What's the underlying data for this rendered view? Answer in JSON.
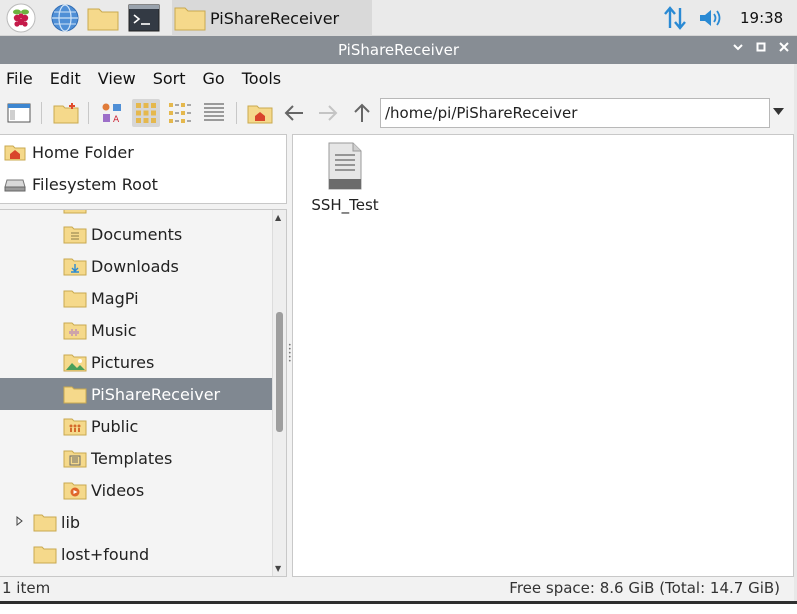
{
  "taskbar": {
    "task_label": "PiShareReceiver",
    "clock": "19:38",
    "icons": [
      "raspberry-menu-icon",
      "browser-icon",
      "file-manager-icon",
      "terminal-icon",
      "network-icon",
      "volume-icon"
    ]
  },
  "window": {
    "title": "PiShareReceiver",
    "controls": [
      "minimize",
      "maximize",
      "close"
    ]
  },
  "menu": {
    "file": "File",
    "edit": "Edit",
    "view": "View",
    "sort": "Sort",
    "go": "Go",
    "tools": "Tools"
  },
  "toolbar": {
    "path": "/home/pi/PiShareReceiver",
    "active_view": "icon-view"
  },
  "places": [
    {
      "label": "Home Folder",
      "icon": "home-icon"
    },
    {
      "label": "Filesystem Root",
      "icon": "drive-icon"
    }
  ],
  "tree": [
    {
      "label": "Documents",
      "icon": "documents-folder-icon",
      "selected": false
    },
    {
      "label": "Downloads",
      "icon": "downloads-folder-icon",
      "selected": false
    },
    {
      "label": "MagPi",
      "icon": "folder-icon",
      "selected": false
    },
    {
      "label": "Music",
      "icon": "music-folder-icon",
      "selected": false
    },
    {
      "label": "Pictures",
      "icon": "pictures-folder-icon",
      "selected": false
    },
    {
      "label": "PiShareReceiver",
      "icon": "folder-icon",
      "selected": true
    },
    {
      "label": "Public",
      "icon": "public-folder-icon",
      "selected": false
    },
    {
      "label": "Templates",
      "icon": "templates-folder-icon",
      "selected": false
    },
    {
      "label": "Videos",
      "icon": "videos-folder-icon",
      "selected": false
    },
    {
      "label": "lib",
      "icon": "folder-icon",
      "selected": false,
      "expandable": true
    },
    {
      "label": "lost+found",
      "icon": "folder-icon",
      "selected": false
    }
  ],
  "files": [
    {
      "name": "SSH_Test",
      "icon": "text-file-icon"
    }
  ],
  "status": {
    "left": "1 item",
    "right": "Free space: 8.6 GiB (Total: 14.7 GiB)"
  },
  "colors": {
    "titlebar": "#878d94",
    "selection": "#808891",
    "folder": "#f5d98b",
    "accent": "#2a8ad4"
  }
}
